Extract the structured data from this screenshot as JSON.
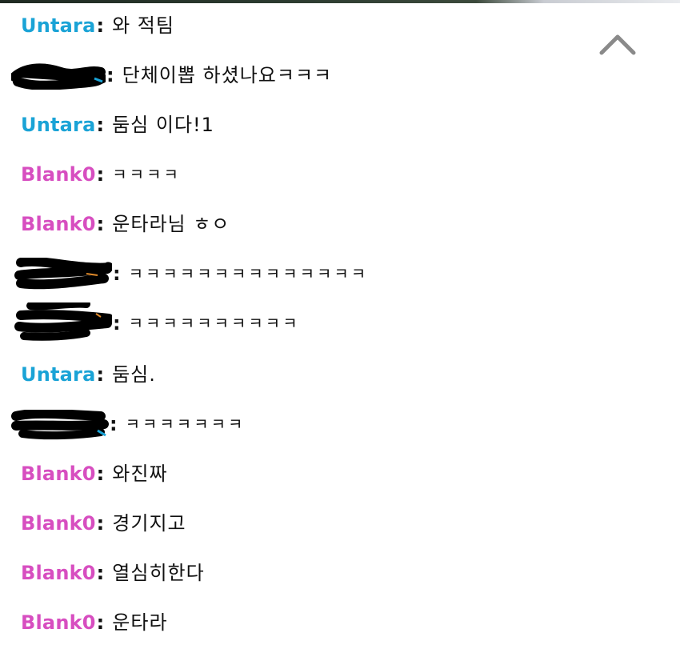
{
  "colors": {
    "untara": "#1aa3d6",
    "blanko": "#d74ec0",
    "text": "#111111",
    "chevron": "#8a8a8a"
  },
  "icons": {
    "scroll_up": "chevron-up-icon",
    "redaction": "redaction-scribble"
  },
  "chat": [
    {
      "user": "Untara",
      "user_color": "untara",
      "message": "와 적팀"
    },
    {
      "user": "",
      "user_color": "untara",
      "redacted": true,
      "message": "단체이뽑 하셨나요ㅋㅋㅋ"
    },
    {
      "user": "Untara",
      "user_color": "untara",
      "message": "둠심 이다!1"
    },
    {
      "user": "Blank0",
      "user_color": "blanko",
      "message": "ㅋㅋㅋㅋ"
    },
    {
      "user": "Blank0",
      "user_color": "blanko",
      "message": "운타라님 ㅎㅇ"
    },
    {
      "user": "",
      "user_color": "untara",
      "redacted": true,
      "message": "ㅋㅋㅋㅋㅋㅋㅋㅋㅋㅋㅋㅋㅋㅋ"
    },
    {
      "user": "",
      "user_color": "untara",
      "redacted": true,
      "message": "ㅋㅋㅋㅋㅋㅋㅋㅋㅋㅋ"
    },
    {
      "user": "Untara",
      "user_color": "untara",
      "message": "둠심."
    },
    {
      "user": "",
      "user_color": "untara",
      "redacted": true,
      "message": "ㅋㅋㅋㅋㅋㅋㅋ"
    },
    {
      "user": "Blank0",
      "user_color": "blanko",
      "message": "와진짜"
    },
    {
      "user": "Blank0",
      "user_color": "blanko",
      "message": "경기지고"
    },
    {
      "user": "Blank0",
      "user_color": "blanko",
      "message": "열심히한다"
    },
    {
      "user": "Blank0",
      "user_color": "blanko",
      "message": "운타라"
    }
  ]
}
